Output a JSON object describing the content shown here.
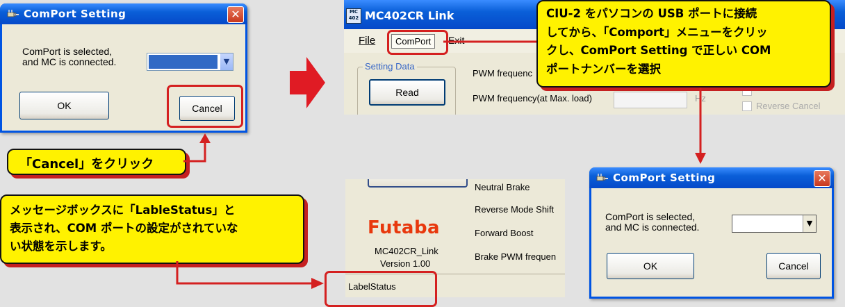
{
  "dialog": {
    "title": "ComPort Setting",
    "message_line1": "ComPort is selected,",
    "message_line2": "and MC is connected.",
    "ok_label": "OK",
    "cancel_label": "Cancel",
    "close_glyph": "✕",
    "combo_arrow": "▼"
  },
  "app": {
    "title": "MC402CR Link",
    "menu_file": "File",
    "menu_comport": "ComPort",
    "menu_exit": "Exit",
    "group_setting": "Setting Data",
    "read_button": "Read",
    "pwm_freq": "PWM frequenc",
    "pwm_freq_max": "PWM frequency(at Max. load)",
    "unit_hz": "Hz",
    "reverse_cancel": "Reverse Cancel",
    "neutral_brake": "Neutral Brake",
    "reverse_mode_shift": "Reverse Mode Shift",
    "forward_boost": "Forward Boost",
    "brake_pwm": "Brake PWM frequen",
    "logo": "Futaba",
    "product": "MC402CR_Link",
    "version": "Version 1.00",
    "status": "LabelStatus"
  },
  "callouts": {
    "cancel_note": "「Cancel」をクリック",
    "comport_note_1": "CIU-2 をパソコンの USB ポートに接続",
    "comport_note_2": "してから、「Comport」メニューをクリッ",
    "comport_note_3": "クし、ComPort Setting で正しい COM",
    "comport_note_4": "ポートナンバーを選択",
    "status_note_1": "メッセージボックスに「LableStatus」と",
    "status_note_2": "表示され、COM ポートの設定がされていな",
    "status_note_3": "い状態を示します。"
  },
  "colors": {
    "xp_blue": "#0054e3",
    "callout_yellow": "#fff200",
    "highlight_red": "#d42020",
    "futaba_red": "#e8380d"
  }
}
